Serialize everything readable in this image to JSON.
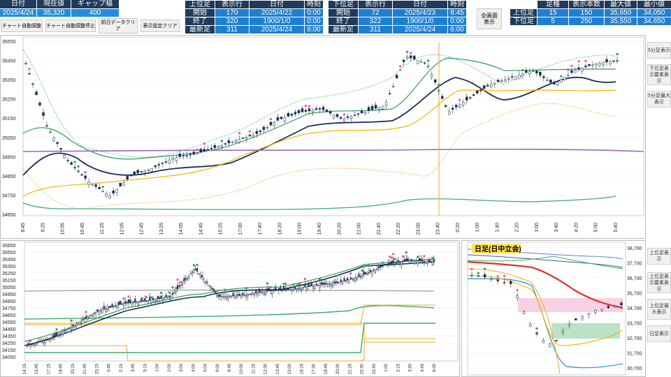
{
  "top_left": {
    "headers": [
      "日付",
      "現在値",
      "ギャップ幅"
    ],
    "values": [
      "2025/4/24",
      "35,320",
      "400"
    ]
  },
  "tool_buttons": {
    "auto_adjust": "チャート自動調整",
    "stop_auto_adjust": "チャート自動調整停止",
    "clear_prev_day": "前日データクリア",
    "clear_display": "表示設定クリア"
  },
  "upper_info": {
    "header": [
      "上位足",
      "表示行",
      "日付",
      "時刻"
    ],
    "rows": [
      {
        "label": "開始",
        "row": "170",
        "date": "2025/4/22",
        "time": "0:00"
      },
      {
        "label": "終了",
        "row": "320",
        "date": "1900/1/0",
        "time": "0:00"
      },
      {
        "label": "最新足",
        "row": "311",
        "date": "2025/4/24",
        "time": "6:00"
      }
    ]
  },
  "lower_info": {
    "header": [
      "下位足",
      "表示行",
      "日付",
      "時刻"
    ],
    "rows": [
      {
        "label": "開始",
        "row": "72",
        "date": "2025/4/23",
        "time": "8:45"
      },
      {
        "label": "終了",
        "row": "322",
        "date": "1900/1/0",
        "time": "0:00"
      },
      {
        "label": "最新足",
        "row": "311",
        "date": "2025/4/24",
        "time": "6:00"
      }
    ]
  },
  "full_screen_button": "全画面\n表示",
  "summary": {
    "header": [
      "",
      "足種",
      "表示本数",
      "最大値",
      "最小値"
    ],
    "rows": [
      [
        "上位足",
        "15",
        "150",
        "35,650",
        "34,050"
      ],
      [
        "下位足",
        "5",
        "250",
        "35,550",
        "34,650"
      ]
    ]
  },
  "right_buttons_top": [
    "5分足表示",
    "下位足表示要素表示",
    "5分足最大表示"
  ],
  "right_buttons_bottom": [
    "上位足表示",
    "上位足表示要素表示",
    "上位足最大表示",
    "日足表示"
  ],
  "upper_chart": {
    "y_labels": [
      "35550",
      "35450",
      "35350",
      "35250",
      "35150",
      "35050",
      "34950",
      "34850",
      "34750",
      "34650"
    ],
    "x_labels": [
      "8:45",
      "9:25",
      "10:05",
      "10:45",
      "11:25",
      "12:05",
      "12:45",
      "13:25",
      "14:05",
      "14:45",
      "15:25",
      "17:00",
      "17:40",
      "18:20",
      "19:00",
      "19:40",
      "20:20",
      "21:00",
      "21:40",
      "22:20",
      "23:00",
      "23:40",
      "0:20",
      "1:00",
      "1:40",
      "2:20",
      "3:00",
      "3:40",
      "4:20",
      "5:00",
      "5:40"
    ]
  },
  "lower_chart": {
    "y_labels": [
      "35650",
      "35550",
      "35450",
      "35350",
      "35250",
      "35150",
      "35050",
      "34950",
      "34850",
      "34750",
      "34650",
      "34550",
      "34450",
      "34350",
      "34250",
      "34150",
      "34050"
    ],
    "x_labels": [
      "14:15",
      "15:45",
      "17:15",
      "18:45",
      "20:15",
      "21:45",
      "23:15",
      "0:45",
      "2:15",
      "3:45",
      "5:15",
      "1:00",
      "2:00",
      "3:00",
      "4:00",
      "5:00",
      "6:00",
      "8:45",
      "10:00",
      "11:15",
      "12:30",
      "13:45",
      "15:00",
      "16:15",
      "17:30",
      "18:45",
      "20:00",
      "21:15",
      "22:30",
      "23:45",
      "1:00",
      "2:15",
      "3:30",
      "4:45",
      "6:00"
    ]
  },
  "daily_chart": {
    "title": "日足(日中立会)",
    "y_labels": [
      "38,700",
      "37,700",
      "36,700",
      "35,700",
      "34,700",
      "33,700",
      "32,700",
      "31,700",
      "30,700"
    ]
  },
  "colors": {
    "header_bg": "#1f3a5a",
    "value_bg": "#1e8fe0",
    "sma_navy": "#1a2f5a",
    "ema_green": "#2e9e5e",
    "band_orange": "#f5b800",
    "purple_line": "#9a6ab8",
    "pink_marker": "#ff4fa8"
  }
}
